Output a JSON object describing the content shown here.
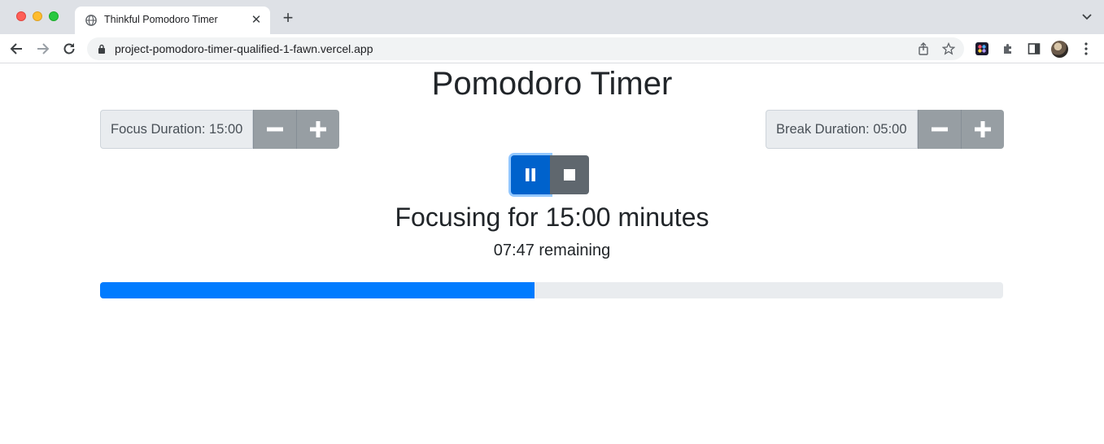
{
  "browser": {
    "tab_title": "Thinkful Pomodoro Timer",
    "url": "project-pomodoro-timer-qualified-1-fawn.vercel.app"
  },
  "page": {
    "title": "Pomodoro Timer",
    "focus_duration_label": "Focus Duration: 15:00",
    "break_duration_label": "Break Duration: 05:00",
    "session_title": "Focusing for 15:00 minutes",
    "remaining": "07:47 remaining",
    "progress_fraction": 0.481
  },
  "icons": {
    "decrease": "minus-icon",
    "increase": "plus-icon",
    "pause": "pause-icon",
    "stop": "stop-icon"
  },
  "colors": {
    "primary": "#007bff",
    "secondary": "#6c757d"
  }
}
